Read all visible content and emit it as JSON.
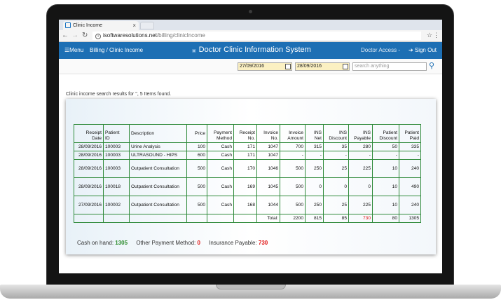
{
  "browser": {
    "tab_title": "Clinic Income",
    "tab_close": "×",
    "url_domain": "isoftwaresolutions.net",
    "url_path": "/billing/clinicIncome"
  },
  "header": {
    "menu_label": "☰Menu",
    "breadcrumb": "Billing / Clinic Income",
    "title": "Doctor Clinic Information System",
    "access": "Doctor Access -",
    "signout": "➔ Sign Out"
  },
  "filters": {
    "date_from": "27/09/2016",
    "date_to": "28/09/2016",
    "search_placeholder": "search anything"
  },
  "results_text": "Clinic income search results for '', 5 Items found.",
  "table": {
    "headers": [
      [
        "Receipt",
        "Date"
      ],
      [
        "Patient",
        "ID"
      ],
      [
        "Description"
      ],
      [
        "Price"
      ],
      [
        "Payment",
        "Method"
      ],
      [
        "Receipt",
        "No."
      ],
      [
        "Invoice",
        "No."
      ],
      [
        "Invoice",
        "Amount"
      ],
      [
        "INS",
        "Net"
      ],
      [
        "INS",
        "Discount"
      ],
      [
        "INS",
        "Payable"
      ],
      [
        "Patient",
        "Discount"
      ],
      [
        "Patient",
        "Paid"
      ]
    ],
    "rows": [
      [
        "28/09/2016",
        "100003",
        "Urine Analysis",
        "100",
        "Cash",
        "171",
        "1047",
        "700",
        "315",
        "35",
        "280",
        "50",
        "335"
      ],
      [
        "28/09/2016",
        "100003",
        "ULTRASOUND - HIPS",
        "600",
        "Cash",
        "171",
        "1047",
        "-",
        "-",
        "-",
        "-",
        "-",
        "-"
      ],
      [
        "28/09/2016",
        "100003",
        "Outpatient Consultation",
        "500",
        "Cash",
        "170",
        "1046",
        "500",
        "250",
        "25",
        "225",
        "10",
        "240"
      ],
      [
        "28/09/2016",
        "100018",
        "Outpatient Consultation",
        "500",
        "Cash",
        "169",
        "1045",
        "500",
        "0",
        "0",
        "0",
        "10",
        "490"
      ],
      [
        "27/09/2016",
        "100002",
        "Outpatient Consultation",
        "500",
        "Cash",
        "168",
        "1044",
        "500",
        "250",
        "25",
        "225",
        "10",
        "240"
      ]
    ],
    "totals": {
      "label": "Total:",
      "invoice_amount": "2200",
      "ins_net": "815",
      "ins_discount": "85",
      "ins_payable": "730",
      "patient_discount": "80",
      "patient_paid": "1305"
    }
  },
  "summary": {
    "cash_label": "Cash on hand:",
    "cash_value": "1305",
    "other_label": "Other Payment Method:",
    "other_value": "0",
    "ins_label": "Insurance Payable:",
    "ins_value": "730"
  },
  "colors": {
    "header_bg": "#1d6fb4",
    "table_border": "#2f8a3a",
    "date_input_bg": "#fbf0c2",
    "cash_value": "#2a8a2a",
    "alert_value": "#e01010"
  }
}
